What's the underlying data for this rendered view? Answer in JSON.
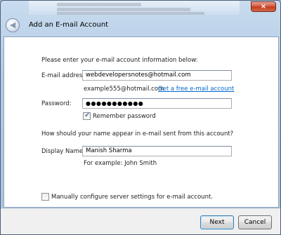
{
  "window": {
    "title": "Add an E-mail Account",
    "close_glyph": "×",
    "back_glyph": "◀"
  },
  "form": {
    "intro": "Please enter your e-mail account information below:",
    "email_label": "E-mail address:",
    "email_value": "webdevelopersnotes@hotmail.com",
    "email_example": "example555@hotmail.com",
    "free_account_link": "Get a free e-mail account",
    "password_label": "Password:",
    "password_value": "●●●●●●●●●●●",
    "remember_password_label": "Remember password",
    "remember_password_checked": true,
    "name_question": "How should your name appear in e-mail sent from this account?",
    "display_name_label": "Display Name:",
    "display_name_value": "Manish Sharma",
    "display_name_example": "For example: John Smith",
    "manual_config_label": "Manually configure server settings for e-mail account.",
    "manual_config_checked": false
  },
  "footer": {
    "next_label": "Next",
    "cancel_label": "Cancel"
  },
  "colors": {
    "link": "#0066cc",
    "close_button": "#c13a1e",
    "frame": "#a9c3de"
  }
}
